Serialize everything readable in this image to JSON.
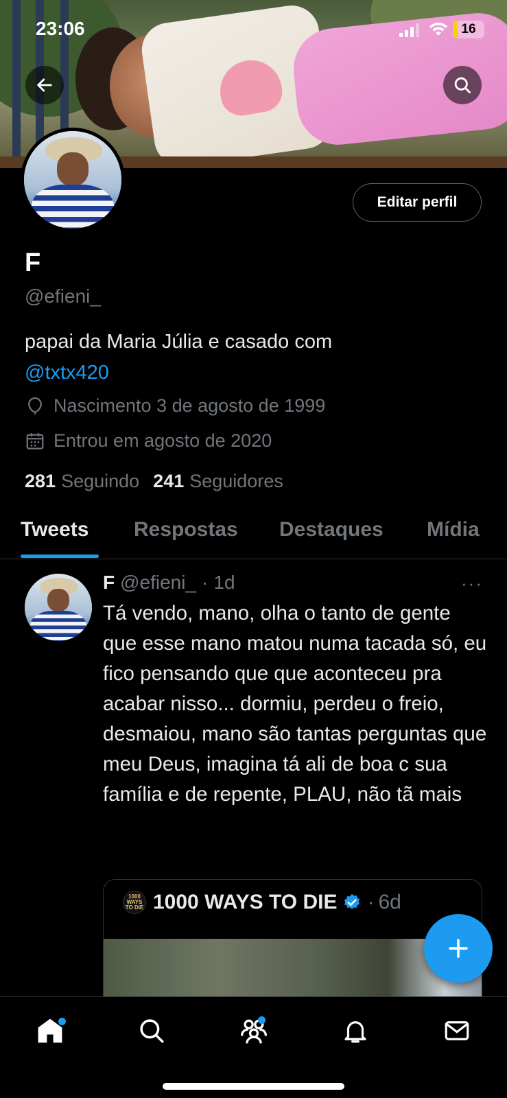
{
  "status_bar": {
    "time": "23:06",
    "battery": "16",
    "battery_level": 0.16
  },
  "profile": {
    "name": "F",
    "handle": "@efieni_",
    "bio_text": "papai da Maria Júlia e casado com",
    "bio_mention": "@txtx420",
    "birth": "Nascimento 3 de agosto de 1999",
    "joined": "Entrou em agosto de 2020",
    "following_count": "281",
    "following_label": "Seguindo",
    "followers_count": "241",
    "followers_label": "Seguidores",
    "edit_button": "Editar perfil"
  },
  "tabs": [
    {
      "label": "Tweets",
      "active": true
    },
    {
      "label": "Respostas",
      "active": false
    },
    {
      "label": "Destaques",
      "active": false
    },
    {
      "label": "Mídia",
      "active": false
    }
  ],
  "tweet": {
    "name": "F",
    "handle": "@efieni_",
    "separator": "·",
    "time": "1d",
    "more": "···",
    "text": "Tá vendo, mano, olha o tanto de gente que esse mano matou numa tacada só, eu fico pensando que que aconteceu pra acabar nisso... dormiu, perdeu o freio, desmaiou, mano são tantas perguntas que meu Deus, imagina tá ali de boa c sua família e de repente, PLAU, não tã mais",
    "quote": {
      "logo_text": "1000 WAYS TO DIE",
      "name": "1000 WAYS TO DIE",
      "separator": "·",
      "time": "6d"
    }
  },
  "colors": {
    "accent": "#1d9bf0",
    "background": "#000000",
    "muted": "#71767b",
    "text": "#e7e9ea"
  },
  "icons": {
    "back": "arrow-left-icon",
    "search": "search-icon",
    "birth": "balloon-icon",
    "joined": "calendar-icon",
    "verified": "verified-badge-icon",
    "compose": "plus-icon",
    "nav": [
      "home-icon",
      "search-icon",
      "communities-icon",
      "bell-icon",
      "mail-icon"
    ]
  }
}
